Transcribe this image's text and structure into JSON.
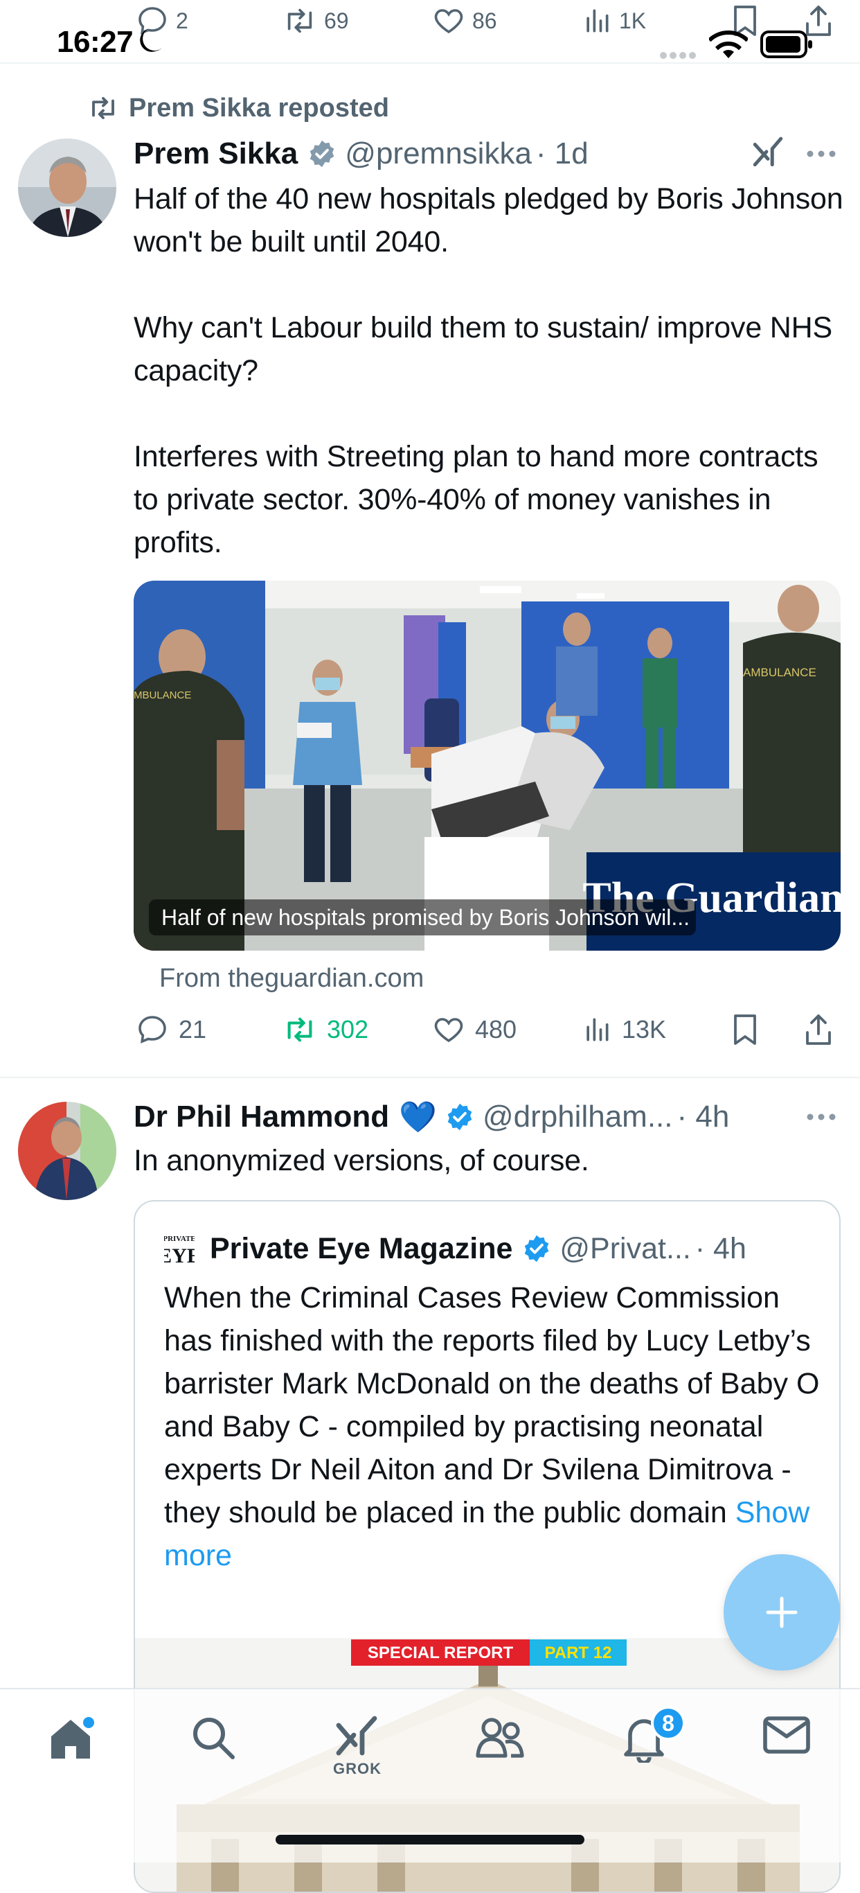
{
  "status_bar": {
    "time": "16:27"
  },
  "prev_tweet_actions": {
    "replies": "2",
    "reposts": "69",
    "likes": "86",
    "views": "1K"
  },
  "tweet1": {
    "repost_label": "Prem Sikka reposted",
    "author_name": "Prem Sikka",
    "handle": "@premnsikka",
    "time": "· 1d",
    "body": "Half of the 40 new hospitals pledged by Boris Johnson won't be built until 2040.\n\nWhy can't Labour build them to sustain/ improve NHS capacity?\n\nInterferes with Streeting plan to hand more contracts to private sector. 30%-40% of money vanishes in profits.",
    "card": {
      "caption": "Half of new hospitals promised by Boris Johnson wil...",
      "logo_text": "The Guardian",
      "ambulance_text_left": "MBULANCE",
      "ambulance_text_right": "AMBULANCE",
      "source": "From theguardian.com"
    },
    "actions": {
      "replies": "21",
      "reposts": "302",
      "likes": "480",
      "views": "13K"
    }
  },
  "tweet2": {
    "author_name": "Dr Phil Hammond",
    "author_emoji": "💙",
    "handle": "@drphilham...",
    "time": "· 4h",
    "body": "In anonymized versions, of course.",
    "quote": {
      "logo_line1": "PRIVATE",
      "logo_line2": "EYE",
      "author_name": "Private Eye Magazine",
      "handle": "@Privat...",
      "time": "· 4h",
      "body": "When the Criminal Cases Review Commission has finished with the reports filed by Lucy Letby’s barrister Mark McDonald on the deaths of Baby O and Baby C - compiled by practising neonatal experts Dr Neil Aiton and Dr Svilena Dimitrova - they should be placed in the public domain ",
      "show_more": "Show more",
      "banner_red": "SPECIAL REPORT",
      "banner_blue": "PART 12"
    }
  },
  "tabbar": {
    "grok_label": "GROK",
    "notifications_badge": "8"
  },
  "colors": {
    "accent": "#1d9bf0",
    "repost_green": "#00ba7c",
    "muted": "#536471"
  }
}
